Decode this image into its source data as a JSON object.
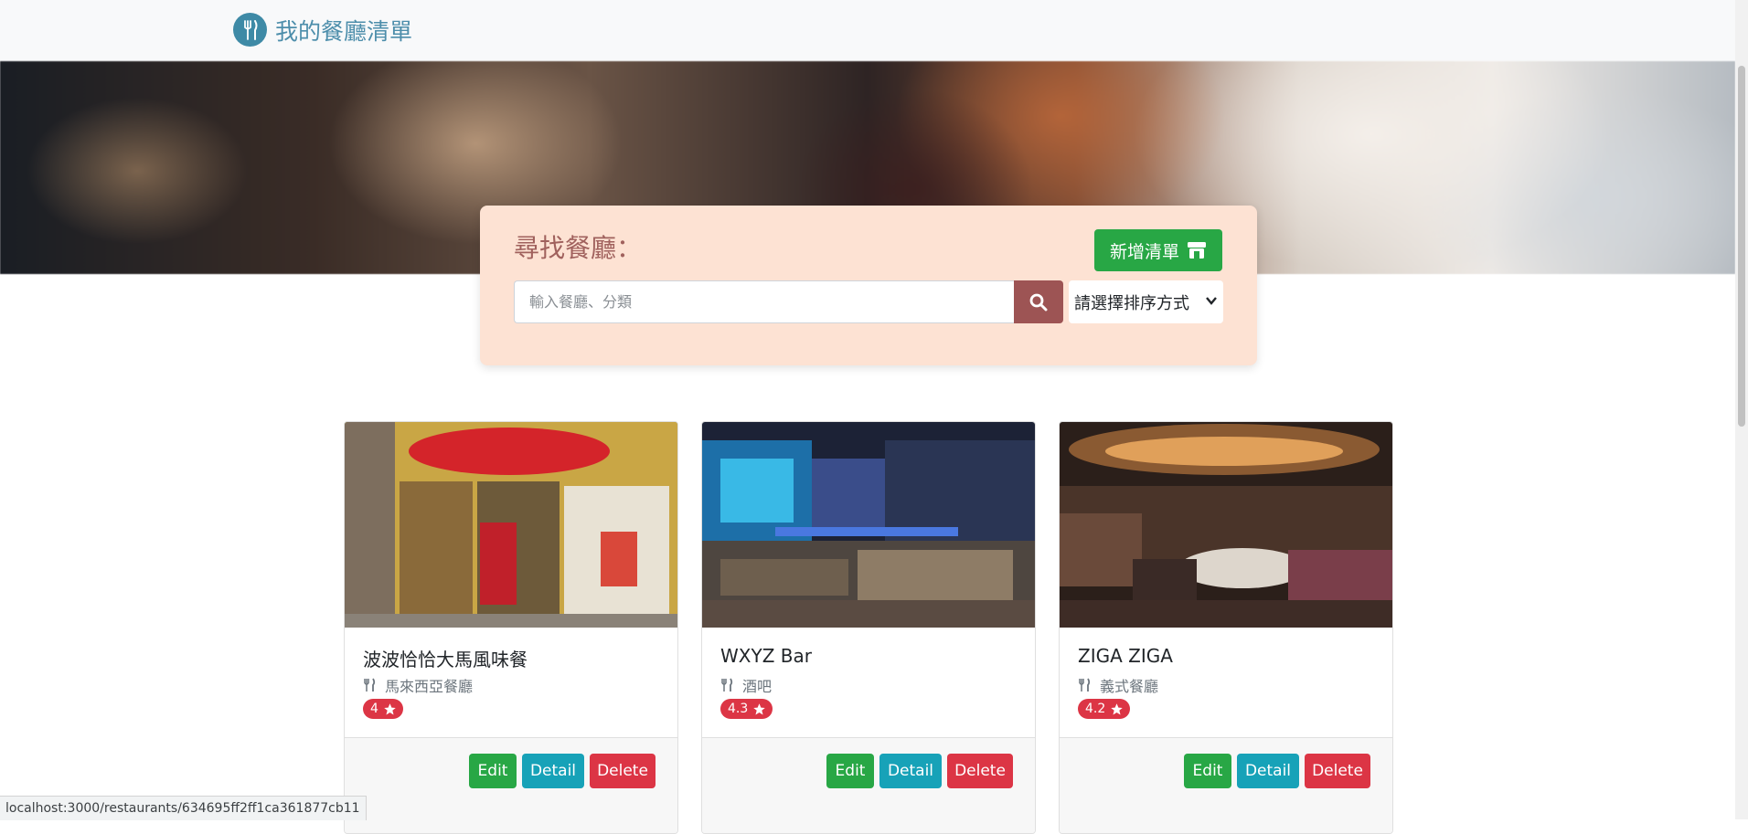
{
  "navbar": {
    "title": "我的餐廳清單",
    "icon": "utensils-icon"
  },
  "search": {
    "title": "尋找餐廳：",
    "add_label": "新增清單",
    "placeholder": "輸入餐廳、分類",
    "sort_label": "請選擇排序方式"
  },
  "colors": {
    "brand": "#3e8aa6",
    "panel": "#fde2d3",
    "search_title": "#a0615d",
    "success": "#28a745",
    "info": "#17a2b8",
    "danger": "#dc3545"
  },
  "restaurants": [
    {
      "name": "波波恰恰大馬風味餐",
      "category": "馬來西亞餐廳",
      "rating": "4",
      "edit": "Edit",
      "detail": "Detail",
      "delete": "Delete"
    },
    {
      "name": "WXYZ Bar",
      "category": "酒吧",
      "rating": "4.3",
      "edit": "Edit",
      "detail": "Detail",
      "delete": "Delete"
    },
    {
      "name": "ZIGA ZIGA",
      "category": "義式餐廳",
      "rating": "4.2",
      "edit": "Edit",
      "detail": "Detail",
      "delete": "Delete"
    }
  ],
  "status_url": "localhost:3000/restaurants/634695ff2ff1ca361877cb11"
}
